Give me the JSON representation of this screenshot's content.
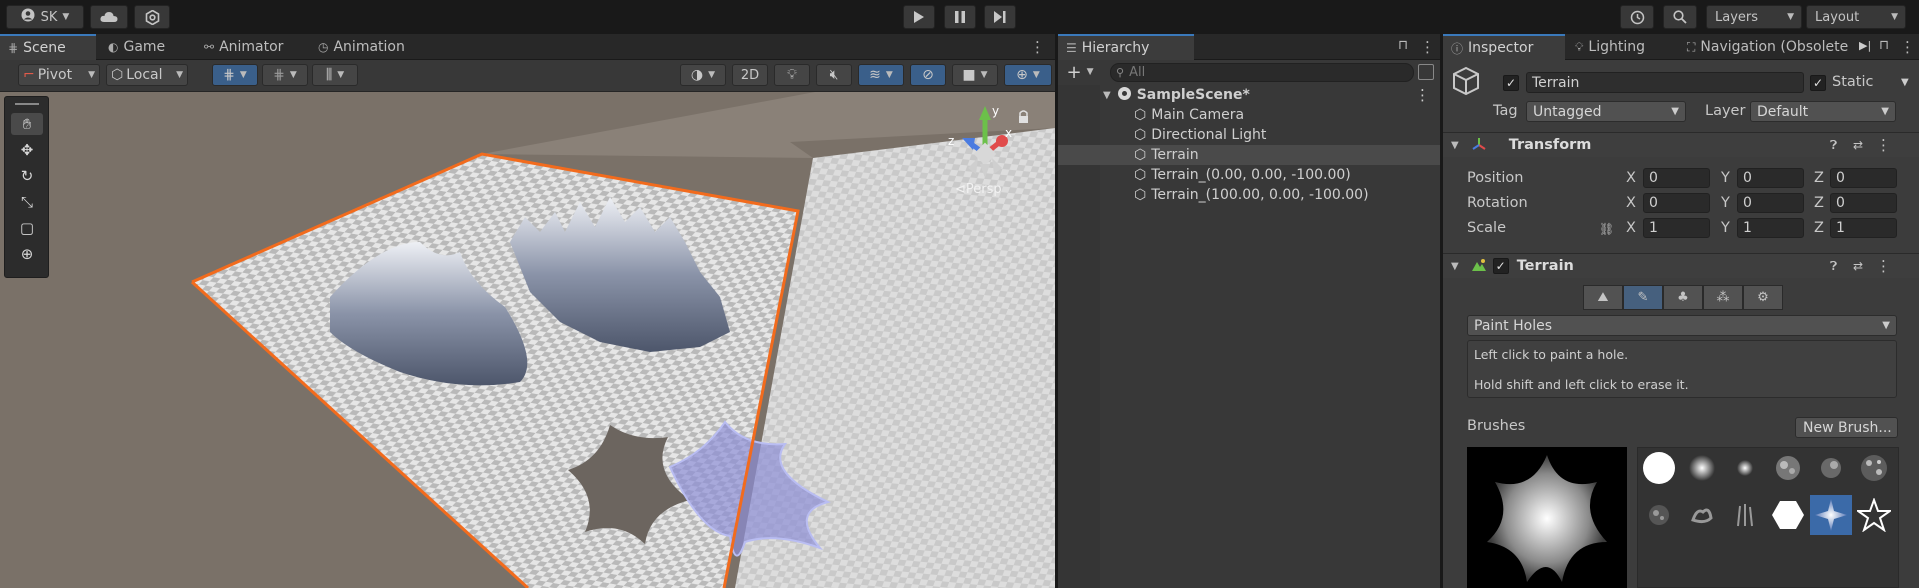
{
  "account": {
    "initials": "SK"
  },
  "toolbar": {
    "layers_label": "Layers",
    "layout_label": "Layout"
  },
  "scene_panel": {
    "tabs": [
      {
        "label": "Scene"
      },
      {
        "label": "Game"
      },
      {
        "label": "Animator"
      },
      {
        "label": "Animation"
      }
    ],
    "pivot_label": "Pivot",
    "space_label": "Local",
    "mode_2d_label": "2D",
    "persp_label": "⊲Persp",
    "gizmo_axes": {
      "y": "y",
      "x": "x",
      "z": "z"
    }
  },
  "hierarchy": {
    "tab_label": "Hierarchy",
    "search_placeholder": "All",
    "scene_name": "SampleScene*",
    "items": [
      {
        "label": "Main Camera"
      },
      {
        "label": "Directional Light"
      },
      {
        "label": "Terrain"
      },
      {
        "label": "Terrain_(0.00, 0.00, -100.00)"
      },
      {
        "label": "Terrain_(100.00, 0.00, -100.00)"
      }
    ],
    "selected": "Terrain"
  },
  "inspector": {
    "tabs": [
      {
        "label": "Inspector"
      },
      {
        "label": "Lighting"
      },
      {
        "label": "Navigation (Obsolete"
      }
    ],
    "object_name": "Terrain",
    "static_label": "Static",
    "tag_label": "Tag",
    "tag_value": "Untagged",
    "layer_label": "Layer",
    "layer_value": "Default",
    "transform": {
      "title": "Transform",
      "position_label": "Position",
      "rotation_label": "Rotation",
      "scale_label": "Scale",
      "axes": [
        "X",
        "Y",
        "Z"
      ],
      "position": [
        "0",
        "0",
        "0"
      ],
      "rotation": [
        "0",
        "0",
        "0"
      ],
      "scale": [
        "1",
        "1",
        "1"
      ]
    },
    "terrain": {
      "title": "Terrain",
      "tool_mode": "Paint Holes",
      "help_line1": "Left click to paint a hole.",
      "help_line2": "Hold shift and left click to erase it.",
      "brushes_label": "Brushes",
      "new_brush_label": "New Brush..."
    }
  },
  "colors": {
    "accent": "#3a79bb",
    "selection_outline": "#f26b1d",
    "tab_indicator": "#3a79bb"
  }
}
